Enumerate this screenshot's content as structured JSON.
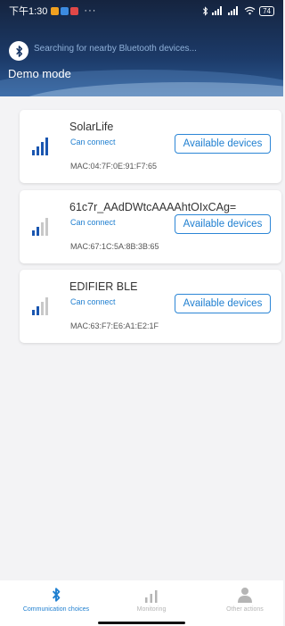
{
  "status_bar": {
    "time": "下午1:30",
    "dots": "···",
    "signal_text": "ᴴᴰ ᴴᴰ",
    "battery": "74"
  },
  "header": {
    "searching_text": "Searching for nearby Bluetooth devices...",
    "mode": "Demo mode"
  },
  "devices": [
    {
      "name": "SolarLife",
      "status": "Can connect",
      "mac": "MAC:04:7F:0E:91:F7:65",
      "button_label": "Available devices",
      "signal_bars": 4
    },
    {
      "name": "61c7r_AAdDWtcAAAAhtOIxCAg=",
      "status": "Can connect",
      "mac": "MAC:67:1C:5A:8B:3B:65",
      "button_label": "Available devices",
      "signal_bars": 2
    },
    {
      "name": "EDIFIER BLE",
      "status": "Can connect",
      "mac": "MAC:63:F7:E6:A1:E2:1F",
      "button_label": "Available devices",
      "signal_bars": 2
    }
  ],
  "tabbar": {
    "tabs": [
      {
        "label": "Communication choices",
        "icon": "bluetooth-icon",
        "active": true
      },
      {
        "label": "Monitoring",
        "icon": "signal-bars-icon",
        "active": false
      },
      {
        "label": "Other actions",
        "icon": "person-icon",
        "active": false
      }
    ]
  },
  "colors": {
    "accent": "#1f7fd0",
    "inactive": "#b5b5b5",
    "signal_active": "#1a56b0",
    "signal_inactive": "#c8c8c8"
  }
}
